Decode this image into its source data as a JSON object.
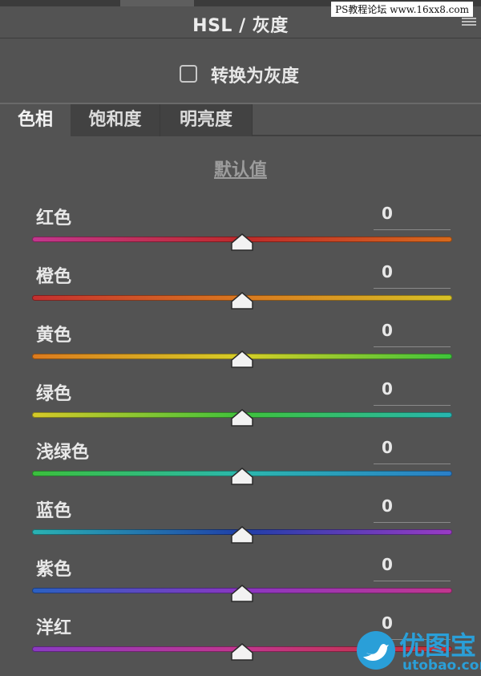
{
  "panel": {
    "title": "HSL / 灰度",
    "watermark": "PS教程论坛 www.16xx8.com",
    "convert_to_gray": {
      "label": "转换为灰度",
      "checked": false
    },
    "tabs": [
      {
        "label": "色相",
        "active": true
      },
      {
        "label": "饱和度",
        "active": false
      },
      {
        "label": "明亮度",
        "active": false
      }
    ],
    "defaults_link": "默认值",
    "sliders": [
      {
        "label": "红色",
        "value": "0",
        "colors": [
          "#c2368e",
          "#bf2a2a",
          "#d86a1c"
        ]
      },
      {
        "label": "橙色",
        "value": "0",
        "colors": [
          "#c42f2f",
          "#d9781f",
          "#d8c326"
        ]
      },
      {
        "label": "黄色",
        "value": "0",
        "colors": [
          "#dc7a1e",
          "#d6ce27",
          "#3ec43b"
        ]
      },
      {
        "label": "绿色",
        "value": "0",
        "colors": [
          "#d7c928",
          "#3fc23c",
          "#27b6b0"
        ]
      },
      {
        "label": "浅绿色",
        "value": "0",
        "colors": [
          "#3bbf3c",
          "#2bb7ad",
          "#2a7ec8"
        ]
      },
      {
        "label": "蓝色",
        "value": "0",
        "colors": [
          "#2ab3b3",
          "#1f3fa8",
          "#9a3bc4"
        ]
      },
      {
        "label": "紫色",
        "value": "0",
        "colors": [
          "#2a60c2",
          "#8a36c2",
          "#c2368e"
        ]
      },
      {
        "label": "洋红",
        "value": "0",
        "colors": [
          "#8a3ac2",
          "#c2368e",
          "#c53030"
        ]
      }
    ]
  },
  "logo": {
    "text": "优图宝",
    "url": "utobao.com",
    "color": "#2a9fd8"
  }
}
